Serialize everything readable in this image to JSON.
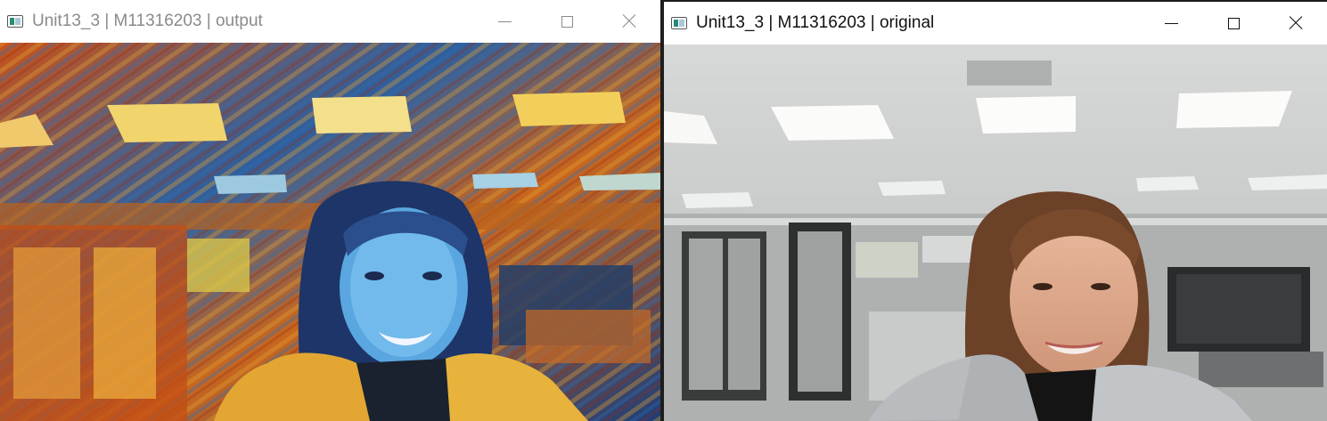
{
  "windows": {
    "output": {
      "title": "Unit13_3 | M11316203 | output",
      "frame": "stylized-webcam-frame"
    },
    "original": {
      "title": "Unit13_3 | M11316203 | original",
      "frame": "webcam-frame"
    }
  },
  "controls": {
    "minimize_icon": "minimize-icon",
    "maximize_icon": "maximize-icon",
    "close_icon": "close-icon"
  },
  "colors": {
    "titlebar": "#ffffff",
    "title_inactive": "#8a8a8a",
    "title_active": "#111111"
  }
}
